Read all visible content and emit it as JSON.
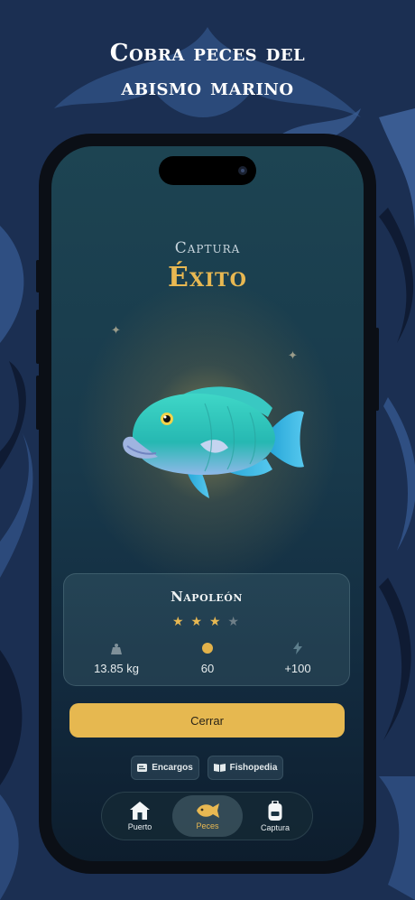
{
  "promo": {
    "line1": "Cobra peces del",
    "line2": "abismo marino"
  },
  "capture": {
    "label": "Captura",
    "result": "Éxito"
  },
  "fish": {
    "name": "Napoleón",
    "rating": 3,
    "rating_max": 5,
    "weight": "13.85 kg",
    "coins": "60",
    "xp": "+100"
  },
  "buttons": {
    "close": "Cerrar"
  },
  "links": {
    "orders": "Encargos",
    "fishopedia": "Fishopedia"
  },
  "nav": {
    "items": [
      {
        "label": "Puerto",
        "icon": "house-icon"
      },
      {
        "label": "Peces",
        "icon": "fish-icon",
        "active": true
      },
      {
        "label": "Captura",
        "icon": "backpack-icon"
      }
    ]
  },
  "colors": {
    "accent": "#e8b852",
    "background": "#1d3358"
  }
}
